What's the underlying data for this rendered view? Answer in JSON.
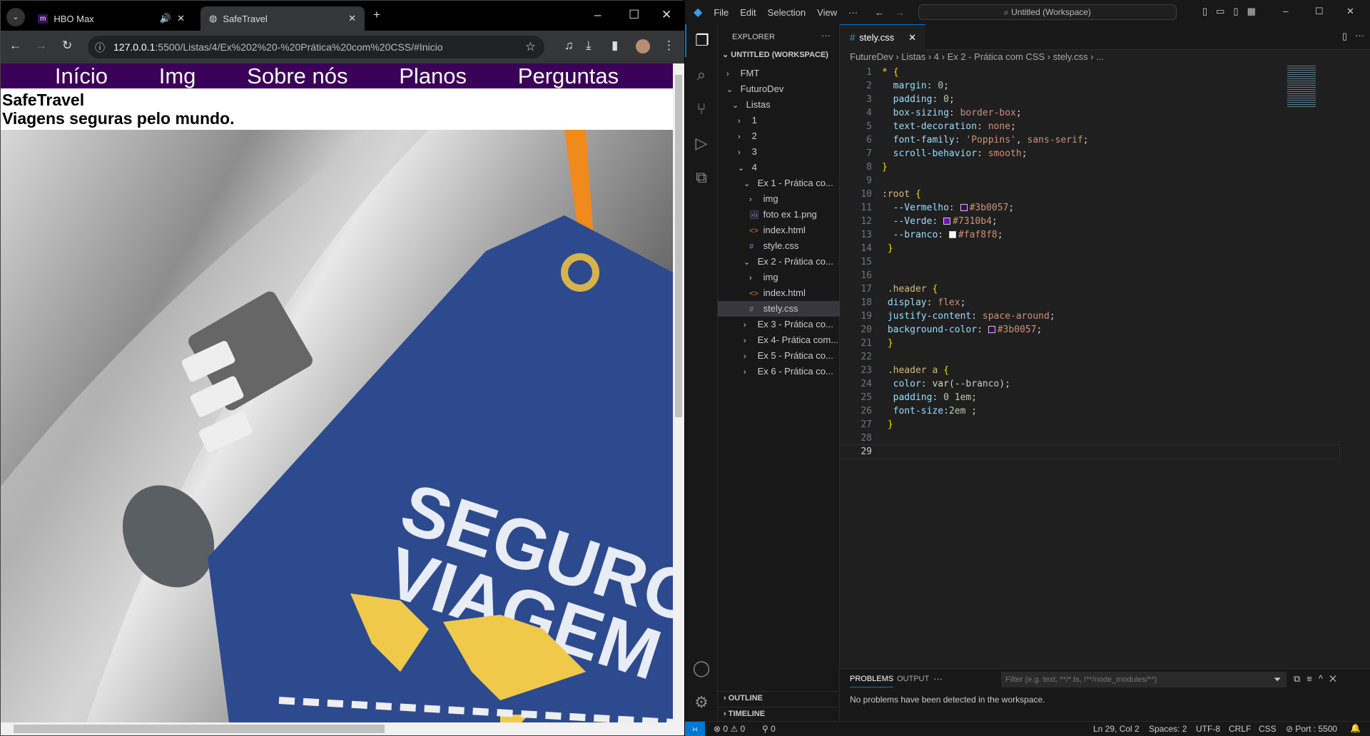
{
  "browser": {
    "tabs": [
      {
        "title": "HBO Max",
        "icon": "hbo-icon"
      },
      {
        "title": "SafeTravel",
        "icon": "globe-icon"
      }
    ],
    "url_host": "127.0.0.1",
    "url_rest": ":5500/Listas/4/Ex%202%20-%20Prática%20com%20CSS/#Inicio",
    "page": {
      "nav": [
        "Início",
        "Img",
        "Sobre nós",
        "Planos",
        "Perguntas"
      ],
      "title": "SafeTravel",
      "subtitle": "Viagens seguras pelo mundo.",
      "photo_text_1": "SEGURO",
      "photo_text_2": "VIAGEM",
      "colors": {
        "header": "#3b0057",
        "tag": "#2d4a8f",
        "map": "#f0c94b"
      }
    }
  },
  "vscode": {
    "menu": [
      "File",
      "Edit",
      "Selection",
      "View",
      "···"
    ],
    "command_center": "Untitled (Workspace)",
    "explorer_title": "EXPLORER",
    "workspace": "UNTITLED (WORKSPACE)",
    "tree": [
      {
        "label": "FMT",
        "depth": 0,
        "kind": "folder",
        "open": false
      },
      {
        "label": "FuturoDev",
        "depth": 0,
        "kind": "folder",
        "open": true
      },
      {
        "label": "Listas",
        "depth": 1,
        "kind": "folder",
        "open": true
      },
      {
        "label": "1",
        "depth": 2,
        "kind": "folder",
        "open": false
      },
      {
        "label": "2",
        "depth": 2,
        "kind": "folder",
        "open": false
      },
      {
        "label": "3",
        "depth": 2,
        "kind": "folder",
        "open": false
      },
      {
        "label": "4",
        "depth": 2,
        "kind": "folder",
        "open": true
      },
      {
        "label": "Ex 1 - Prática co...",
        "depth": 3,
        "kind": "folder",
        "open": true
      },
      {
        "label": "img",
        "depth": 4,
        "kind": "folder",
        "open": false
      },
      {
        "label": "foto ex 1.png",
        "depth": 4,
        "kind": "image"
      },
      {
        "label": "index.html",
        "depth": 4,
        "kind": "html"
      },
      {
        "label": "style.css",
        "depth": 4,
        "kind": "css"
      },
      {
        "label": "Ex 2 - Prática co...",
        "depth": 3,
        "kind": "folder",
        "open": true
      },
      {
        "label": "img",
        "depth": 4,
        "kind": "folder",
        "open": false
      },
      {
        "label": "index.html",
        "depth": 4,
        "kind": "html"
      },
      {
        "label": "stely.css",
        "depth": 4,
        "kind": "css",
        "selected": true
      },
      {
        "label": "Ex 3 - Prática co...",
        "depth": 3,
        "kind": "folder",
        "open": false
      },
      {
        "label": "Ex 4- Prática com...",
        "depth": 3,
        "kind": "folder",
        "open": false
      },
      {
        "label": "Ex 5 - Prática co...",
        "depth": 3,
        "kind": "folder",
        "open": false
      },
      {
        "label": "Ex 6 - Prática co...",
        "depth": 3,
        "kind": "folder",
        "open": false
      }
    ],
    "outline": "OUTLINE",
    "timeline": "TIMELINE",
    "editor_tab": "stely.css",
    "breadcrumb": [
      "FutureDev",
      "Listas",
      "4",
      "Ex 2 - Prática com CSS",
      "stely.css",
      "..."
    ],
    "code": [
      [
        [
          "b",
          "* {"
        ]
      ],
      [
        [
          "p",
          "  margin"
        ],
        [
          "w",
          ": "
        ],
        [
          "n",
          "0"
        ],
        [
          "w",
          ";"
        ]
      ],
      [
        [
          "p",
          "  padding"
        ],
        [
          "w",
          ": "
        ],
        [
          "n",
          "0"
        ],
        [
          "w",
          ";"
        ]
      ],
      [
        [
          "p",
          "  box-sizing"
        ],
        [
          "w",
          ": "
        ],
        [
          "v",
          "border-box"
        ],
        [
          "w",
          ";"
        ]
      ],
      [
        [
          "p",
          "  text-decoration"
        ],
        [
          "w",
          ": "
        ],
        [
          "v",
          "none"
        ],
        [
          "w",
          ";"
        ]
      ],
      [
        [
          "p",
          "  font-family"
        ],
        [
          "w",
          ": "
        ],
        [
          "v",
          "'Poppins'"
        ],
        [
          "w",
          ", "
        ],
        [
          "v",
          "sans-serif"
        ],
        [
          "w",
          ";"
        ]
      ],
      [
        [
          "p",
          "  scroll-behavior"
        ],
        [
          "w",
          ": "
        ],
        [
          "v",
          "smooth"
        ],
        [
          "w",
          ";"
        ]
      ],
      [
        [
          "b",
          "}"
        ]
      ],
      [],
      [
        [
          "s",
          ":root "
        ],
        [
          "b",
          "{"
        ]
      ],
      [
        [
          "p",
          "  --Vermelho"
        ],
        [
          "w",
          ": "
        ],
        [
          "sw",
          "#3b0057"
        ],
        [
          "v",
          "#3b0057"
        ],
        [
          "w",
          ";"
        ]
      ],
      [
        [
          "p",
          "  --Verde"
        ],
        [
          "w",
          ": "
        ],
        [
          "sw",
          "#7310b4"
        ],
        [
          "v",
          "#7310b4"
        ],
        [
          "w",
          ";"
        ]
      ],
      [
        [
          "p",
          "  --branco"
        ],
        [
          "w",
          ": "
        ],
        [
          "sw",
          "#faf8f8"
        ],
        [
          "v",
          "#faf8f8"
        ],
        [
          "w",
          ";"
        ]
      ],
      [
        [
          "b",
          " }"
        ]
      ],
      [],
      [],
      [
        [
          "s",
          " .header "
        ],
        [
          "b",
          "{"
        ]
      ],
      [
        [
          "p",
          " display"
        ],
        [
          "w",
          ": "
        ],
        [
          "v",
          "flex"
        ],
        [
          "w",
          ";"
        ]
      ],
      [
        [
          "p",
          " justify-content"
        ],
        [
          "w",
          ": "
        ],
        [
          "v",
          "space-around"
        ],
        [
          "w",
          ";"
        ]
      ],
      [
        [
          "p",
          " background-color"
        ],
        [
          "w",
          ": "
        ],
        [
          "sw",
          "#3b0057"
        ],
        [
          "v",
          "#3b0057"
        ],
        [
          "w",
          ";"
        ]
      ],
      [
        [
          "b",
          " }"
        ]
      ],
      [],
      [
        [
          "s",
          " .header a "
        ],
        [
          "b",
          "{"
        ]
      ],
      [
        [
          "p",
          "  color"
        ],
        [
          "w",
          ": "
        ],
        [
          "f",
          "var"
        ],
        [
          "w",
          "(--branco);"
        ]
      ],
      [
        [
          "p",
          "  padding"
        ],
        [
          "w",
          ": "
        ],
        [
          "n",
          "0 1em"
        ],
        [
          "w",
          ";"
        ]
      ],
      [
        [
          "p",
          "  font-size"
        ],
        [
          "w",
          ":"
        ],
        [
          "n",
          "2em"
        ],
        [
          "w",
          " ;"
        ]
      ],
      [
        [
          "b",
          " }"
        ]
      ],
      [],
      []
    ],
    "current_line": 29,
    "panel": {
      "tabs": [
        "PROBLEMS",
        "OUTPUT",
        "···"
      ],
      "filter_placeholder": "Filter (e.g. text, **/*.ts, !**/node_modules/**)",
      "message": "No problems have been detected in the workspace."
    },
    "status": {
      "errors": "0",
      "warnings": "0",
      "ports": "0",
      "position": "Ln 29, Col 2",
      "spaces": "Spaces: 2",
      "encoding": "UTF-8",
      "eol": "CRLF",
      "language": "CSS",
      "port": "Port : 5500"
    }
  }
}
